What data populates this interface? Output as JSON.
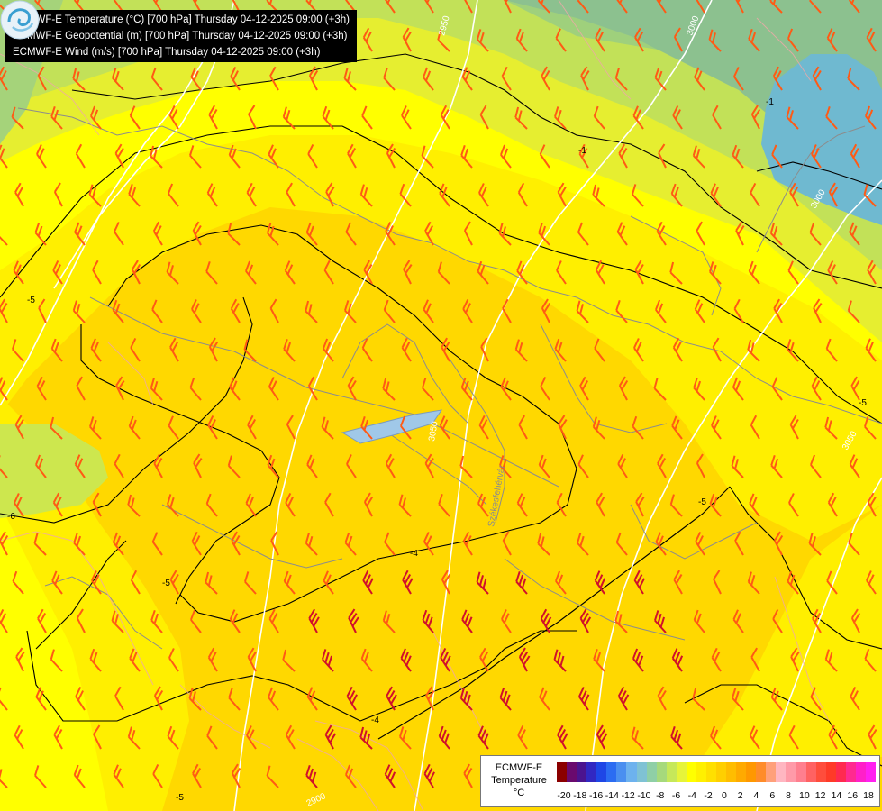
{
  "map": {
    "info_lines": [
      "ECMWF-E Temperature (°C) [700 hPa] Thursday 04-12-2025 09:00 (+3h)",
      "ECMWF-E Geopotential (m) [700 hPa] Thursday 04-12-2025 09:00 (+3h)",
      "ECMWF-E Wind (m/s) [700 hPa] Thursday 04-12-2025 09:00 (+3h)"
    ],
    "isotherm_labels": [
      "-1",
      "-1",
      "-5",
      "-5",
      "-6",
      "-4",
      "-5",
      "-4",
      "-5",
      "-5"
    ],
    "geopotential_labels": [
      "2950",
      "3000",
      "3000",
      "3050",
      "3050",
      "2900"
    ],
    "place_label": "Székesfehérvár",
    "colors": {
      "field_warm": "#ffd400",
      "field_mid": "#ffe500",
      "field_yellow": "#ffff00",
      "field_yellowgreen": "#e3ee2e",
      "field_lightgreen": "#bfe35a",
      "field_green": "#9bd07a",
      "field_teal": "#8cc08c",
      "field_blue": "#6fb8cf",
      "wind_barb": "#ff5a14",
      "wind_barb_strong": "#d0102a",
      "border": "#8c8c8c",
      "terrain": "#f0a8a8",
      "contour": "#000000",
      "geopotential": "#ffffff"
    }
  },
  "legend": {
    "model": "ECMWF-E",
    "variable": "Temperature",
    "unit": "°C",
    "ticks": [
      "-20",
      "-18",
      "-16",
      "-14",
      "-12",
      "-10",
      "-8",
      "-6",
      "-4",
      "-2",
      "0",
      "2",
      "4",
      "6",
      "8",
      "10",
      "12",
      "14",
      "16",
      "18"
    ],
    "swatch_colors": [
      "#8b0000",
      "#6a0a6e",
      "#4b148f",
      "#3128c2",
      "#1e46e6",
      "#2b6cf2",
      "#4a8ff0",
      "#6db2ee",
      "#7fc2d4",
      "#8fcfa6",
      "#a6d97c",
      "#c6e85a",
      "#e6f43a",
      "#ffff00",
      "#fff000",
      "#ffe000",
      "#ffcf00",
      "#ffbd00",
      "#ffaa00",
      "#ff9800",
      "#ff8c2a",
      "#ffa07a",
      "#ffb6c1",
      "#ff9aa8",
      "#ff7f8e",
      "#ff6262",
      "#ff4d3c",
      "#ff3a28",
      "#ff2a50",
      "#ff2a90",
      "#ff20c8",
      "#ff20f0"
    ]
  }
}
